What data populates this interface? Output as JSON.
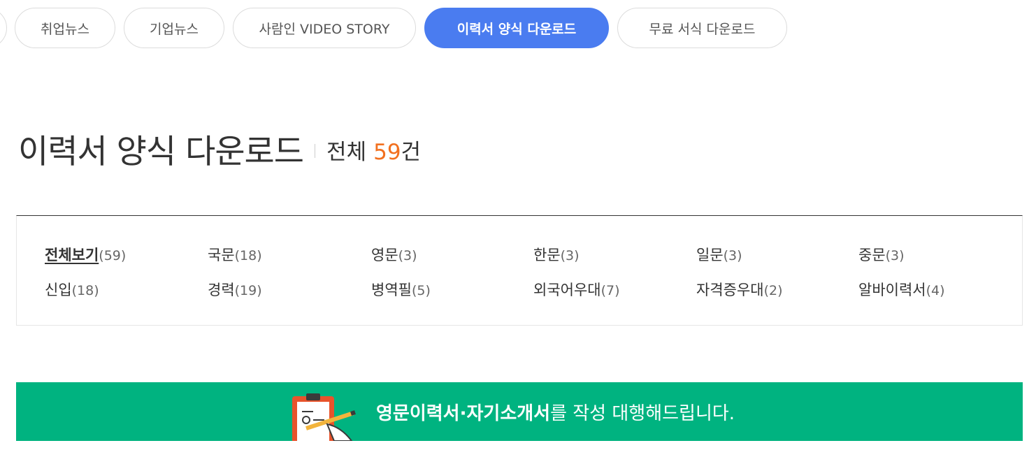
{
  "tabs": [
    {
      "label": "취업뉴스"
    },
    {
      "label": "기업뉴스"
    },
    {
      "label": "사람인 VIDEO STORY"
    },
    {
      "label": "이력서 양식 다운로드"
    },
    {
      "label": "무료 서식 다운로드"
    }
  ],
  "active_tab": 3,
  "heading": {
    "title": "이력서 양식 다운로드",
    "total_prefix": "전체",
    "total_count": "59",
    "total_suffix": "건"
  },
  "categories": [
    {
      "name": "전체보기",
      "count": "(59)"
    },
    {
      "name": "국문",
      "count": "(18)"
    },
    {
      "name": "영문",
      "count": "(3)"
    },
    {
      "name": "한문",
      "count": "(3)"
    },
    {
      "name": "일문",
      "count": "(3)"
    },
    {
      "name": "중문",
      "count": "(3)"
    },
    {
      "name": "신입",
      "count": "(18)"
    },
    {
      "name": "경력",
      "count": "(19)"
    },
    {
      "name": "병역필",
      "count": "(5)"
    },
    {
      "name": "외국어우대",
      "count": "(7)"
    },
    {
      "name": "자격증우대",
      "count": "(2)"
    },
    {
      "name": "알바이력서",
      "count": "(4)"
    }
  ],
  "active_category": 0,
  "banner": {
    "bold_text": "영문이력서·자기소개서",
    "text": "를 작성 대행해드립니다."
  },
  "colors": {
    "accent": "#4a7cf0",
    "count": "#f2701f",
    "banner": "#00b380"
  }
}
